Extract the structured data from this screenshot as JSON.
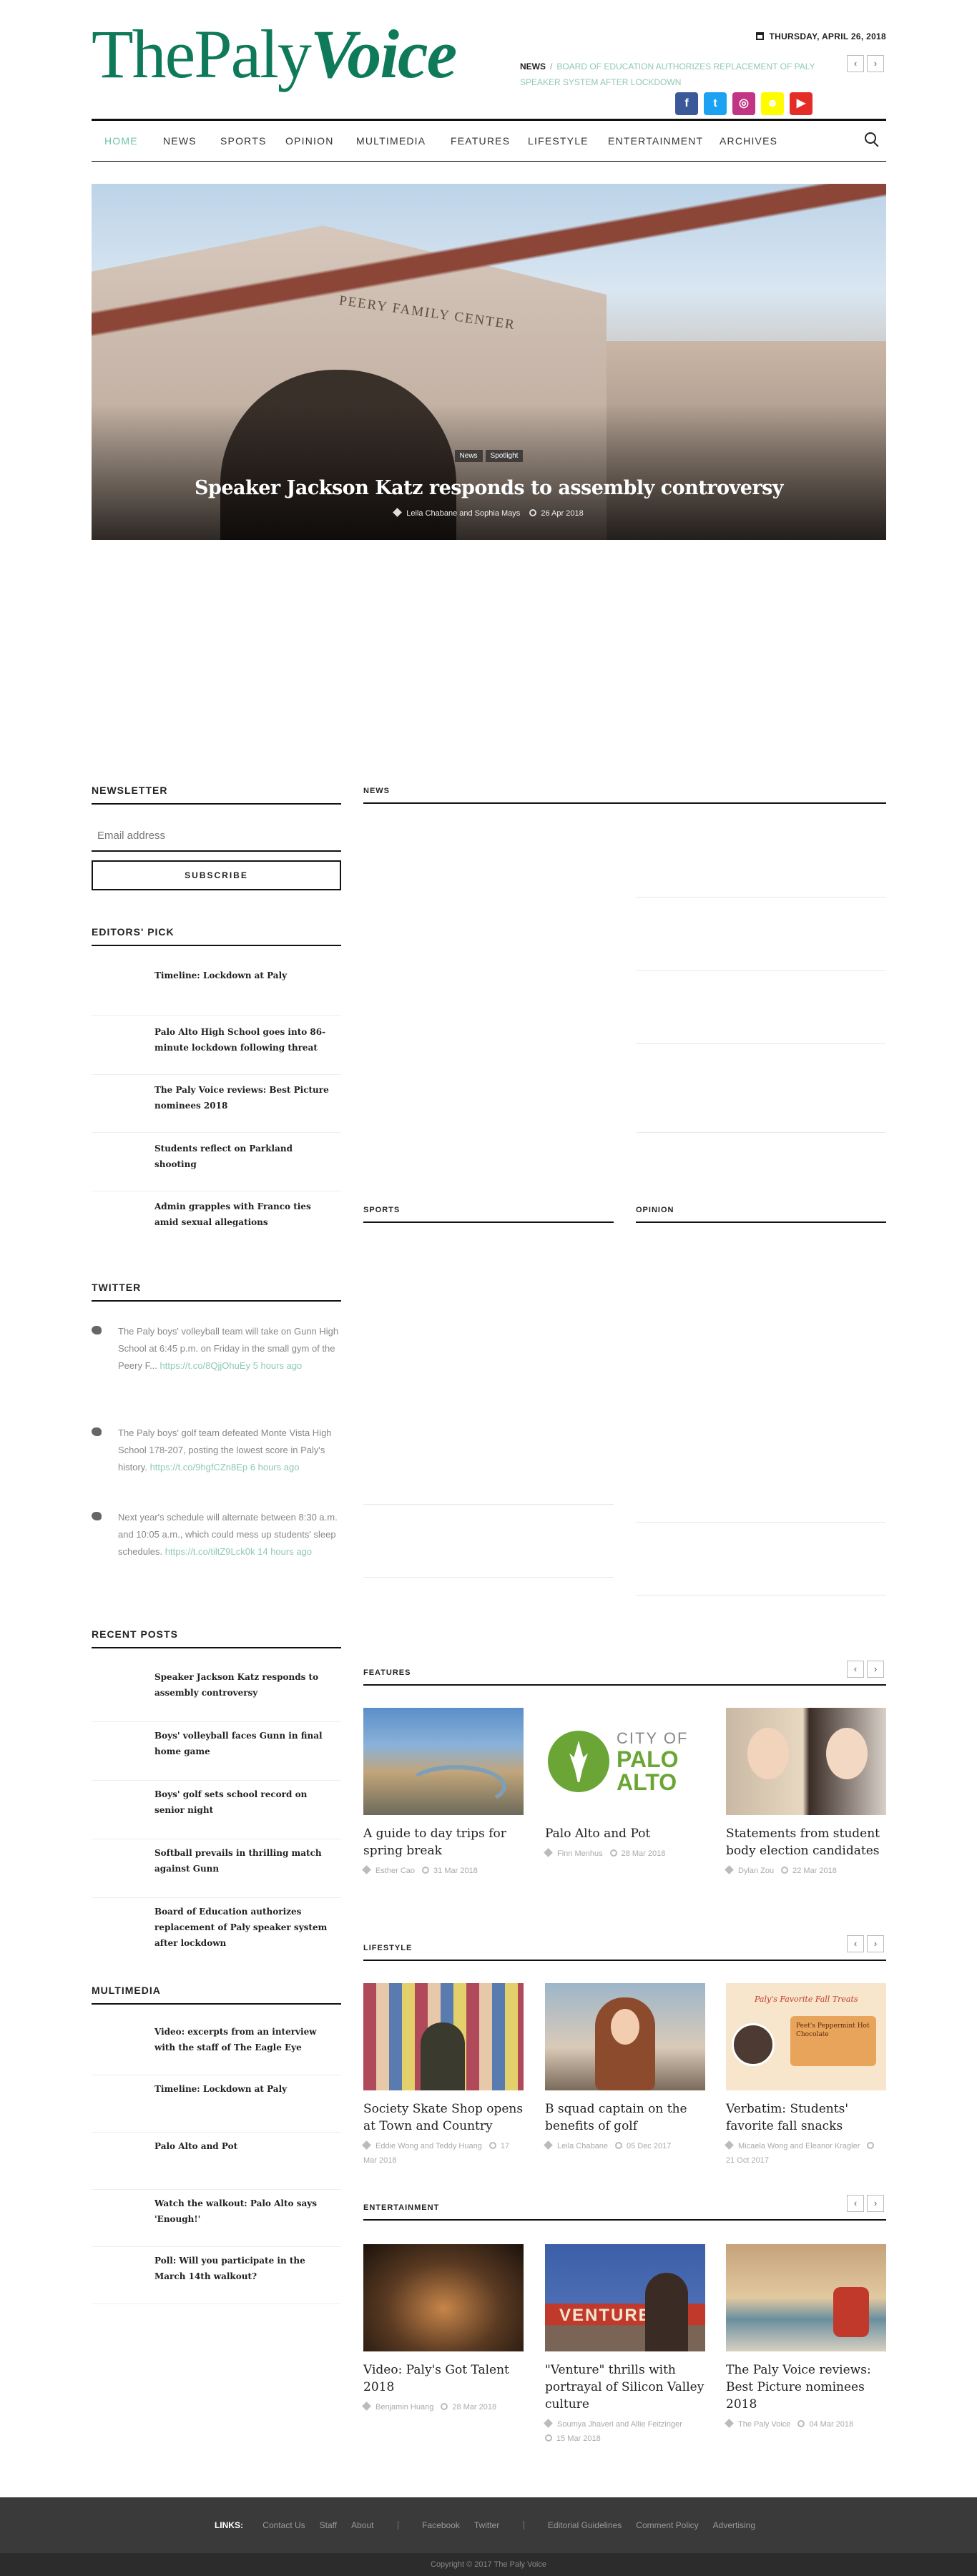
{
  "header": {
    "logo_main": "ThePaly",
    "logo_accent": "Voice",
    "date": "THURSDAY, APRIL 26, 2018",
    "ticker_label": "NEWS",
    "ticker_sep": "/",
    "ticker_text": "BOARD OF EDUCATION AUTHORIZES REPLACEMENT OF PALY SPEAKER SYSTEM AFTER LOCKDOWN",
    "social": [
      {
        "name": "facebook-icon",
        "glyph": "f",
        "color": "#3b5998"
      },
      {
        "name": "twitter-icon",
        "glyph": "t",
        "color": "#1da1f2"
      },
      {
        "name": "instagram-icon",
        "glyph": "◎",
        "color": "#c13584"
      },
      {
        "name": "snapchat-icon",
        "glyph": "☻",
        "color": "#fffc00"
      },
      {
        "name": "youtube-icon",
        "glyph": "▶",
        "color": "#e52d27"
      }
    ]
  },
  "nav": [
    "HOME",
    "NEWS",
    "SPORTS",
    "OPINION",
    "MULTIMEDIA",
    "FEATURES",
    "LIFESTYLE",
    "ENTERTAINMENT",
    "ARCHIVES"
  ],
  "hero": {
    "tags": [
      "News",
      "Spotlight"
    ],
    "sign": "PEERY FAMILY CENTER",
    "title": "Speaker Jackson Katz responds to assembly controversy",
    "author1": "Leila Chabane",
    "and": "and",
    "author2": "Sophia Mays",
    "date": "26 Apr 2018"
  },
  "sections": {
    "newsletter": "NEWSLETTER",
    "email_placeholder": "Email address",
    "subscribe": "SUBSCRIBE",
    "editors_pick": "EDITORS' PICK",
    "twitter": "TWITTER",
    "recent_posts": "RECENT POSTS",
    "multimedia": "MULTIMEDIA",
    "news": "NEWS",
    "sports": "SPORTS",
    "opinion": "OPINION",
    "features": "FEATURES",
    "lifestyle": "LIFESTYLE",
    "entertainment": "ENTERTAINMENT"
  },
  "editors_pick": [
    "Timeline: Lockdown at Paly",
    "Palo Alto High School goes into 86-minute lockdown following threat",
    "The Paly Voice reviews: Best Picture nominees 2018",
    "Students reflect on Parkland shooting",
    "Admin grapples with Franco ties amid sexual allegations"
  ],
  "tweets": [
    {
      "text": "The Paly boys' volleyball team will take on Gunn High School at 6:45 p.m. on Friday in the small gym of the Peery F...",
      "link": "https://t.co/8QjjOhuEy",
      "time": "5 hours ago"
    },
    {
      "text": "The Paly boys' golf team defeated Monte Vista High School 178-207, posting the lowest score in Paly's history.",
      "link": "https://t.co/9hgfCZn8Ep",
      "time": "6 hours ago"
    },
    {
      "text": "Next year's schedule will alternate between 8:30 a.m. and 10:05 a.m., which could mess up students' sleep schedules.",
      "link": "https://t.co/tiltZ9Lck0k",
      "time": "14 hours ago"
    }
  ],
  "recent_posts": [
    "Speaker Jackson Katz responds to assembly controversy",
    "Boys' volleyball faces Gunn in final home game",
    "Boys' golf sets school record on senior night",
    "Softball prevails in thrilling match against Gunn",
    "Board of Education authorizes replacement of Paly speaker system after lockdown"
  ],
  "multimedia": [
    "Video: excerpts from an interview with the staff of The Eagle Eye",
    "Timeline: Lockdown at Paly",
    "Palo Alto and Pot",
    "Watch the walkout: Palo Alto says 'Enough!'",
    "Poll: Will you participate in the March 14th walkout?"
  ],
  "features": [
    {
      "title": "A guide to day trips for spring break",
      "author": "Esther Cao",
      "date": "31 Mar 2018"
    },
    {
      "title": "Palo Alto and Pot",
      "author": "Finn Menhus",
      "date": "28 Mar 2018",
      "img_text1": "CITY OF",
      "img_text2": "PALO",
      "img_text3": "ALTO"
    },
    {
      "title": "Statements from student body election candidates",
      "author": "Dylan Zou",
      "date": "22 Mar 2018"
    }
  ],
  "lifestyle": [
    {
      "title": "Society Skate Shop opens at Town and Country",
      "author": "Eddie Wong and Teddy Huang",
      "date": "17 Mar 2018"
    },
    {
      "title": "B squad captain on the benefits of golf",
      "author": "Leila Chabane",
      "date": "05 Dec 2017"
    },
    {
      "title": "Verbatim: Students' favorite fall snacks",
      "author": "Micaela Wong and Eleanor Kragler",
      "date": "21 Oct 2017",
      "img_text1": "Paly's Favorite Fall Treats",
      "img_text2": "Peet's Peppermint Hot Chocolate"
    }
  ],
  "entertainment": [
    {
      "title": "Video: Paly's Got Talent 2018",
      "author": "Benjamin Huang",
      "date": "28 Mar 2018"
    },
    {
      "title": "\"Venture\" thrills with portrayal of Silicon Valley culture",
      "author": "Soumya Jhaveri and Allie Feitzinger",
      "date": "15 Mar 2018",
      "img_text1": "VENTURE"
    },
    {
      "title": "The Paly Voice reviews: Best Picture nominees 2018",
      "author": "The Paly Voice",
      "date": "04 Mar 2018"
    }
  ],
  "footer": {
    "links_label": "LINKS:",
    "group1": [
      "Contact Us",
      "Staff",
      "About"
    ],
    "group2": [
      "Facebook",
      "Twitter"
    ],
    "group3": [
      "Editorial Guidelines",
      "Comment Policy",
      "Advertising"
    ],
    "copyright": "Copyright © 2017 The Paly Voice"
  },
  "colors": {
    "accent": "#0e7a5a",
    "link": "#8fc9b4"
  }
}
